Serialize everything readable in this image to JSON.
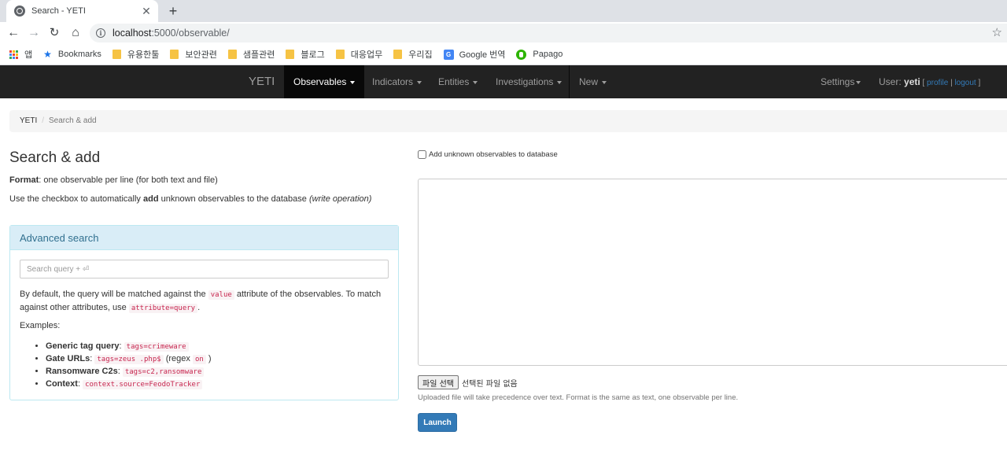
{
  "browser": {
    "tab": {
      "title": "Search - YETI",
      "favicon": "globe-icon",
      "close_glyph": "✕"
    },
    "new_tab_glyph": "+",
    "url_host": "localhost",
    "url_path": ":5000/observable/",
    "bookmarks": [
      {
        "label": "앱",
        "icon": "apps-grid-icon"
      },
      {
        "label": "Bookmarks",
        "icon": "star-icon"
      },
      {
        "label": "유용한툴",
        "icon": "folder-icon"
      },
      {
        "label": "보안관련",
        "icon": "folder-icon"
      },
      {
        "label": "샘플관련",
        "icon": "folder-icon"
      },
      {
        "label": "블로그",
        "icon": "folder-icon"
      },
      {
        "label": "대응업무",
        "icon": "folder-icon"
      },
      {
        "label": "우리집",
        "icon": "folder-icon"
      },
      {
        "label": "Google 번역",
        "icon": "google-translate-icon"
      },
      {
        "label": "Papago",
        "icon": "papago-icon"
      }
    ]
  },
  "navbar": {
    "brand": "YETI",
    "items": [
      {
        "label": "Observables",
        "active": true
      },
      {
        "label": "Indicators",
        "active": false
      },
      {
        "label": "Entities",
        "active": false
      },
      {
        "label": "Investigations",
        "active": false
      },
      {
        "label": "New",
        "active": false
      }
    ],
    "settings_label": "Settings",
    "user": {
      "prefix": "User: ",
      "name": "yeti",
      "open_bracket": " [ ",
      "profile": "profile",
      "separator": " | ",
      "logout": "logout",
      "close_bracket": " ]"
    }
  },
  "breadcrumb": {
    "home": "YETI",
    "separator": "/",
    "current": "Search & add"
  },
  "main": {
    "title": "Search & add",
    "format_label": "Format",
    "format_text": ": one observable per line (for both text and file)",
    "checkbox_hint_pre": "Use the checkbox to automatically ",
    "checkbox_hint_bold": "add",
    "checkbox_hint_post": " unknown observables to the database ",
    "checkbox_hint_italic": "(write operation)"
  },
  "advanced": {
    "heading": "Advanced search",
    "placeholder": "Search query + ⏎",
    "desc_1": "By default, the query will be matched against the ",
    "desc_code1": "value",
    "desc_2": " attribute of the observables. To match against other attributes, use ",
    "desc_code2": "attribute=query",
    "desc_3": ".",
    "examples_label": "Examples:",
    "examples": [
      {
        "label": "Generic tag query",
        "code": "tags=crimeware",
        "suffix": "",
        "code2": "",
        "suffix2": ""
      },
      {
        "label": "Gate URLs",
        "code": "tags=zeus .php$",
        "suffix": " (regex ",
        "code2": "on",
        "suffix2": " )"
      },
      {
        "label": "Ransomware C2s",
        "code": "tags=c2,ransomware",
        "suffix": "",
        "code2": "",
        "suffix2": ""
      },
      {
        "label": "Context",
        "code": "context.source=FeodoTracker",
        "suffix": "",
        "code2": "",
        "suffix2": ""
      }
    ]
  },
  "form": {
    "add_unknown_label": "Add unknown observables to database",
    "add_unknown_checked": false,
    "textarea_value": "",
    "file_button": "파일 선택",
    "file_status": "선택된 파일 없음",
    "help": "Uploaded file will take precedence over text. Format is the same as text, one observable per line.",
    "launch": "Launch"
  },
  "colors": {
    "navbar_bg": "#222222",
    "navbar_active_bg": "#080808",
    "panel_heading_bg": "#d9edf7",
    "panel_heading_text": "#31708f",
    "primary_button": "#337ab7",
    "code_text": "#c7254e",
    "link": "#337ab7"
  }
}
